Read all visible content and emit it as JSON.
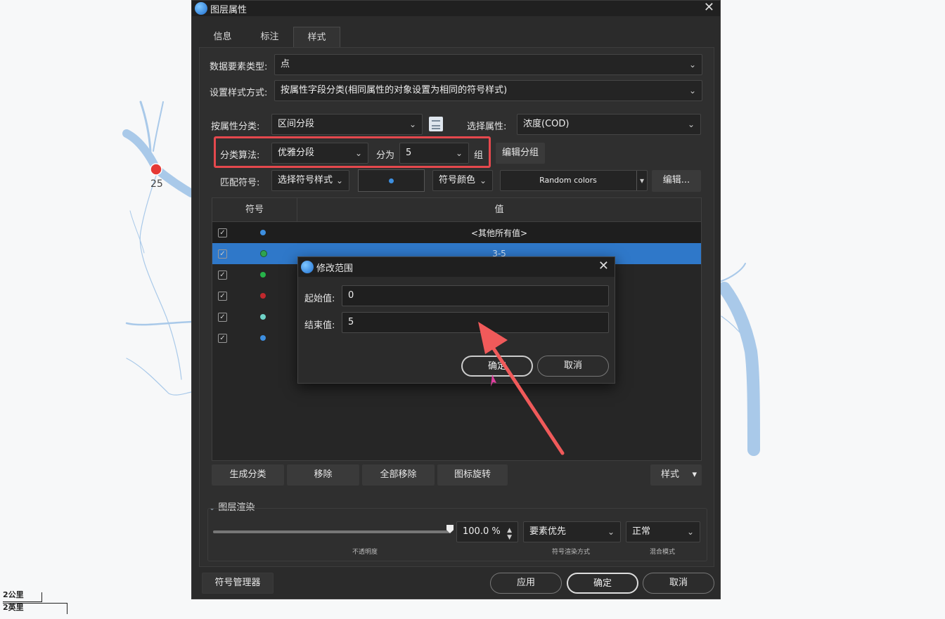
{
  "map": {
    "point_label": "25",
    "scale_top": "2公里",
    "scale_bottom": "2英里",
    "colors": {
      "river": "#a9c9e9",
      "point": "#e53935"
    }
  },
  "dialog": {
    "title": "图层属性",
    "tabs": [
      {
        "label": "信息"
      },
      {
        "label": "标注"
      },
      {
        "label": "样式",
        "active": true
      }
    ],
    "feature_type_label": "数据要素类型:",
    "feature_type_value": "点",
    "style_method_label": "设置样式方式:",
    "style_method_value": "按属性字段分类(相同属性的对象设置为相同的符号样式)",
    "classify_label": "按属性分类:",
    "classify_value": "区间分段",
    "attr_label": "选择属性:",
    "attr_value": "浓度(COD)",
    "algo_label": "分类算法:",
    "algo_value": "优雅分段",
    "divide_label": "分为",
    "divide_value": "5",
    "group_label": "组",
    "edit_group_btn": "编辑分组",
    "match_symbol_label": "匹配符号:",
    "symbol_style_select": "选择符号样式",
    "symbol_color_select": "符号颜色",
    "color_scheme": "Random colors",
    "edit_btn": "编辑...",
    "table": {
      "headers": [
        "符号",
        "值"
      ],
      "rows": [
        {
          "checked": true,
          "color": "#3d8fe0",
          "value": "<其他所有值>",
          "dark": true
        },
        {
          "checked": true,
          "color": "#2ea44f",
          "value": "3-5",
          "selected": true
        },
        {
          "checked": true,
          "color": "#27b34a",
          "value": ""
        },
        {
          "checked": true,
          "color": "#c0282d",
          "value": ""
        },
        {
          "checked": true,
          "color": "#6fd3c8",
          "value": ""
        },
        {
          "checked": true,
          "color": "#3d8fe0",
          "value": ""
        }
      ]
    },
    "buttons": {
      "generate": "生成分类",
      "remove": "移除",
      "remove_all": "全部移除",
      "rotate": "图标旋转",
      "style": "样式"
    },
    "layer_render": {
      "title": "图层渲染",
      "opacity_value": "100.0 %",
      "opacity_fraction": 1.0,
      "render_mode": "要素优先",
      "blend_mode": "正常",
      "caption_opacity": "不透明度",
      "caption_render": "符号渲染方式",
      "caption_blend": "混合模式"
    },
    "footer": {
      "symbol_manager": "符号管理器",
      "apply": "应用",
      "ok": "确定",
      "cancel": "取消"
    }
  },
  "modal": {
    "title": "修改范围",
    "start_label": "起始值:",
    "start_value": "0",
    "end_label": "结束值:",
    "end_value": "5",
    "ok": "确定",
    "cancel": "取消"
  }
}
